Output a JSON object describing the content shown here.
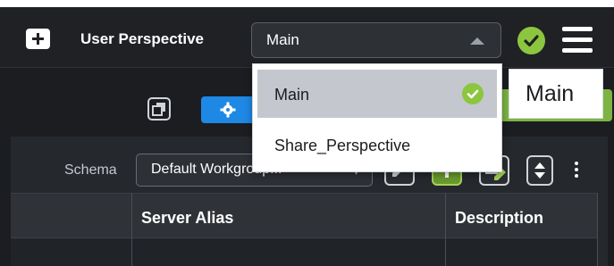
{
  "header": {
    "new_button_icon": "plus-folder-icon",
    "perspective_label": "User Perspective",
    "perspective_select": {
      "value": "Main",
      "options": [
        "Main",
        "Share_Perspective"
      ],
      "selected_index": 0
    },
    "status_icon": "check-circle-icon",
    "status_color": "#8cc63f",
    "menu_icon": "hamburger-menu-icon"
  },
  "toolbar": {
    "copy_icon": "copy-icon",
    "settings_icon": "gear-icon",
    "accent_color": "#1e88e5"
  },
  "schema": {
    "label": "Schema",
    "value": "Default Workgroup..."
  },
  "actions": {
    "edit_icon": "edit-icon",
    "add_icon": "plus-icon",
    "copy_edit_icon": "copy-edit-icon",
    "sort_icon": "sort-icon",
    "more_icon": "more-vertical-icon"
  },
  "table": {
    "columns": [
      "Server Alias",
      "Description"
    ]
  },
  "tooltip": {
    "text": "Main"
  }
}
